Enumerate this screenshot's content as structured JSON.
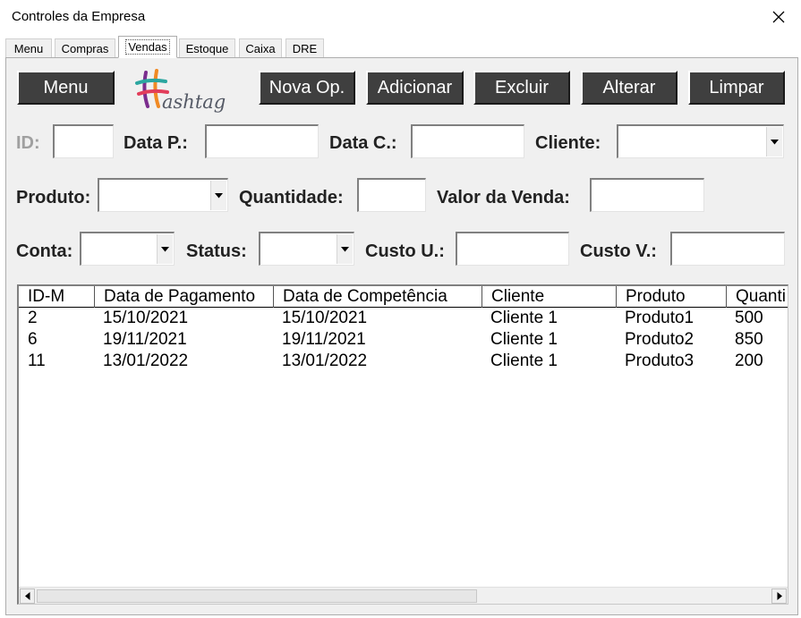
{
  "window": {
    "title": "Controles da Empresa"
  },
  "tabs": [
    {
      "label": "Menu"
    },
    {
      "label": "Compras"
    },
    {
      "label": "Vendas"
    },
    {
      "label": "Estoque"
    },
    {
      "label": "Caixa"
    },
    {
      "label": "DRE"
    }
  ],
  "active_tab": "Vendas",
  "toolbar": {
    "menu_label": "Menu",
    "nova_op_label": "Nova Op.",
    "adicionar_label": "Adicionar",
    "excluir_label": "Excluir",
    "alterar_label": "Alterar",
    "limpar_label": "Limpar"
  },
  "logo": {
    "text": "ashtag"
  },
  "form": {
    "id_label": "ID:",
    "data_p_label": "Data P.:",
    "data_c_label": "Data C.:",
    "cliente_label": "Cliente:",
    "produto_label": "Produto:",
    "quantidade_label": "Quantidade:",
    "valor_venda_label": "Valor da Venda:",
    "conta_label": "Conta:",
    "status_label": "Status:",
    "custo_u_label": "Custo U.:",
    "custo_v_label": "Custo V.:"
  },
  "table": {
    "columns": [
      "ID-M",
      "Data de Pagamento",
      "Data de Competência",
      "Cliente",
      "Produto",
      "Quanti"
    ],
    "rows": [
      [
        "2",
        "15/10/2021",
        "15/10/2021",
        "Cliente 1",
        "Produto1",
        "500"
      ],
      [
        "6",
        "19/11/2021",
        "19/11/2021",
        "Cliente 1",
        "Produto2",
        "850"
      ],
      [
        "11",
        "13/01/2022",
        "13/01/2022",
        "Cliente 1",
        "Produto3",
        "200"
      ]
    ]
  },
  "colors": {
    "button_bg": "#3f3f3f",
    "panel_bg": "#f0f0f0",
    "logo_purple": "#7b2d8e",
    "logo_orange": "#f08a24",
    "logo_teal": "#2ba6a0"
  }
}
